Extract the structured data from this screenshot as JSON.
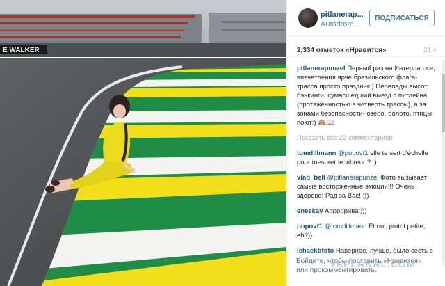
{
  "photo": {
    "billboard_text": "E WALKER"
  },
  "post": {
    "username": "pitlanerapunzel",
    "username_short": "pitlanerap...",
    "location": "Autódrom...",
    "follow_label": "ПОДПИСАТЬСЯ",
    "likes": "2,334 отметок «Нравится»",
    "time": "21 ч"
  },
  "caption": {
    "user": "pitlanerapunzel",
    "text": "Первый раз на Интерлагосе, впечатления ярче бразильского флага- трасса просто праздник:) Перепады высот, бэнкинги, сумасшедший выезд с питлейна (протяженностью в четверть трассы), а за зонами безопасности- озеро, болото, птицы поют:) 🙈📖"
  },
  "view_all": "Показать все 22 комментариев",
  "comments": [
    {
      "user": "tomdillmann",
      "mention": "@popovf1",
      "text": " elle te sert d'échelle pour mesurer le vibreur ? :)"
    },
    {
      "user": "vlad_bell",
      "mention": "@pitlanerapunzel",
      "text": " Фото вызывает самые восторженные эмоции!!! Очень здорово! Рад за Вас! :))"
    },
    {
      "user": "eneskay",
      "mention": "",
      "text": "Арррррива:)))"
    },
    {
      "user": "popovf1",
      "mention": "@tomdillmann",
      "text": " Et oui, plutot petite, eh?))"
    },
    {
      "user": "lehaekbfoto",
      "mention": "",
      "text": "Наверное, лучше, было сесть в желтом платье на зеленую полосу, но фото всё равно отличное!)"
    }
  ],
  "login_prompt": {
    "link": "Войдите",
    "text": ", чтобы поставить «Нравится» или прокомментировать."
  },
  "watermark": "YAPLAKAL.COM",
  "colors": {
    "curb_green": "#1f8d46",
    "curb_yellow": "#f3de1a",
    "curb_white": "#f4f4f2",
    "link_blue": "#125688"
  }
}
